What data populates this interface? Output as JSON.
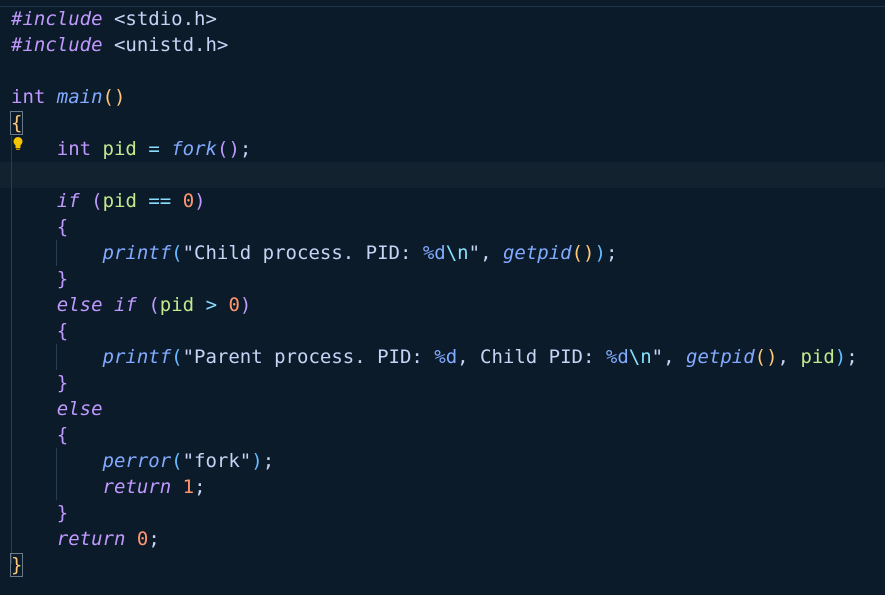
{
  "editor": {
    "lines": [
      {
        "tokens": [
          {
            "t": "#include",
            "c": "kw-pp"
          },
          {
            "t": " ",
            "c": "plain"
          },
          {
            "t": "<stdio.h>",
            "c": "hdr"
          }
        ]
      },
      {
        "tokens": [
          {
            "t": "#include",
            "c": "kw-pp"
          },
          {
            "t": " ",
            "c": "plain"
          },
          {
            "t": "<unistd.h>",
            "c": "hdr"
          }
        ]
      },
      {
        "tokens": []
      },
      {
        "tokens": [
          {
            "t": "int",
            "c": "type"
          },
          {
            "t": " ",
            "c": "plain"
          },
          {
            "t": "main",
            "c": "fn"
          },
          {
            "t": "()",
            "c": "p1"
          }
        ]
      },
      {
        "tokens": [
          {
            "t": "{",
            "c": "p1 cursor-box"
          }
        ]
      },
      {
        "tokens": [
          {
            "t": "    ",
            "c": "plain"
          },
          {
            "t": "int",
            "c": "type"
          },
          {
            "t": " ",
            "c": "plain"
          },
          {
            "t": "pid",
            "c": "var"
          },
          {
            "t": " ",
            "c": "plain"
          },
          {
            "t": "=",
            "c": "op"
          },
          {
            "t": " ",
            "c": "plain"
          },
          {
            "t": "fork",
            "c": "fn"
          },
          {
            "t": "()",
            "c": "p2"
          },
          {
            "t": ";",
            "c": "plain"
          }
        ]
      },
      {
        "tokens": []
      },
      {
        "tokens": [
          {
            "t": "    ",
            "c": "plain"
          },
          {
            "t": "if",
            "c": "kw"
          },
          {
            "t": " ",
            "c": "plain"
          },
          {
            "t": "(",
            "c": "p2"
          },
          {
            "t": "pid",
            "c": "var"
          },
          {
            "t": " ",
            "c": "plain"
          },
          {
            "t": "==",
            "c": "op"
          },
          {
            "t": " ",
            "c": "plain"
          },
          {
            "t": "0",
            "c": "num"
          },
          {
            "t": ")",
            "c": "p2"
          }
        ]
      },
      {
        "tokens": [
          {
            "t": "    ",
            "c": "plain"
          },
          {
            "t": "{",
            "c": "p2"
          }
        ]
      },
      {
        "tokens": [
          {
            "t": "        ",
            "c": "plain"
          },
          {
            "t": "printf",
            "c": "fn"
          },
          {
            "t": "(",
            "c": "p3"
          },
          {
            "t": "\"Child process. PID: ",
            "c": "strlit"
          },
          {
            "t": "%d",
            "c": "fmt"
          },
          {
            "t": "\\n",
            "c": "esc"
          },
          {
            "t": "\"",
            "c": "strlit"
          },
          {
            "t": ", ",
            "c": "plain"
          },
          {
            "t": "getpid",
            "c": "fn"
          },
          {
            "t": "()",
            "c": "p1"
          },
          {
            "t": ")",
            "c": "p3"
          },
          {
            "t": ";",
            "c": "plain"
          }
        ]
      },
      {
        "tokens": [
          {
            "t": "    ",
            "c": "plain"
          },
          {
            "t": "}",
            "c": "p2"
          }
        ]
      },
      {
        "tokens": [
          {
            "t": "    ",
            "c": "plain"
          },
          {
            "t": "else",
            "c": "kw"
          },
          {
            "t": " ",
            "c": "plain"
          },
          {
            "t": "if",
            "c": "kw"
          },
          {
            "t": " ",
            "c": "plain"
          },
          {
            "t": "(",
            "c": "p2"
          },
          {
            "t": "pid",
            "c": "var"
          },
          {
            "t": " ",
            "c": "plain"
          },
          {
            "t": ">",
            "c": "op"
          },
          {
            "t": " ",
            "c": "plain"
          },
          {
            "t": "0",
            "c": "num"
          },
          {
            "t": ")",
            "c": "p2"
          }
        ]
      },
      {
        "tokens": [
          {
            "t": "    ",
            "c": "plain"
          },
          {
            "t": "{",
            "c": "p2"
          }
        ]
      },
      {
        "tokens": [
          {
            "t": "        ",
            "c": "plain"
          },
          {
            "t": "printf",
            "c": "fn"
          },
          {
            "t": "(",
            "c": "p3"
          },
          {
            "t": "\"Parent process. PID: ",
            "c": "strlit"
          },
          {
            "t": "%d",
            "c": "fmt"
          },
          {
            "t": ", Child PID: ",
            "c": "strlit"
          },
          {
            "t": "%d",
            "c": "fmt"
          },
          {
            "t": "\\n",
            "c": "esc"
          },
          {
            "t": "\"",
            "c": "strlit"
          },
          {
            "t": ", ",
            "c": "plain"
          },
          {
            "t": "getpid",
            "c": "fn"
          },
          {
            "t": "()",
            "c": "p1"
          },
          {
            "t": ", ",
            "c": "plain"
          },
          {
            "t": "pid",
            "c": "var"
          },
          {
            "t": ")",
            "c": "p3"
          },
          {
            "t": ";",
            "c": "plain"
          }
        ]
      },
      {
        "tokens": [
          {
            "t": "    ",
            "c": "plain"
          },
          {
            "t": "}",
            "c": "p2"
          }
        ]
      },
      {
        "tokens": [
          {
            "t": "    ",
            "c": "plain"
          },
          {
            "t": "else",
            "c": "kw"
          }
        ]
      },
      {
        "tokens": [
          {
            "t": "    ",
            "c": "plain"
          },
          {
            "t": "{",
            "c": "p2"
          }
        ]
      },
      {
        "tokens": [
          {
            "t": "        ",
            "c": "plain"
          },
          {
            "t": "perror",
            "c": "fn"
          },
          {
            "t": "(",
            "c": "p3"
          },
          {
            "t": "\"fork\"",
            "c": "strlit"
          },
          {
            "t": ")",
            "c": "p3"
          },
          {
            "t": ";",
            "c": "plain"
          }
        ]
      },
      {
        "tokens": [
          {
            "t": "        ",
            "c": "plain"
          },
          {
            "t": "return",
            "c": "kw"
          },
          {
            "t": " ",
            "c": "plain"
          },
          {
            "t": "1",
            "c": "num"
          },
          {
            "t": ";",
            "c": "plain"
          }
        ]
      },
      {
        "tokens": [
          {
            "t": "    ",
            "c": "plain"
          },
          {
            "t": "}",
            "c": "p2"
          }
        ]
      },
      {
        "tokens": [
          {
            "t": "    ",
            "c": "plain"
          },
          {
            "t": "return",
            "c": "kw"
          },
          {
            "t": " ",
            "c": "plain"
          },
          {
            "t": "0",
            "c": "num"
          },
          {
            "t": ";",
            "c": "plain"
          }
        ]
      },
      {
        "tokens": [
          {
            "t": "}",
            "c": "p1 cursor-box"
          }
        ]
      }
    ],
    "lightbulb_icon": "lightbulb-icon",
    "colors": {
      "background": "#0c1b2a",
      "current_line": "#12222f",
      "indent_guide": "#2a3d50"
    }
  }
}
